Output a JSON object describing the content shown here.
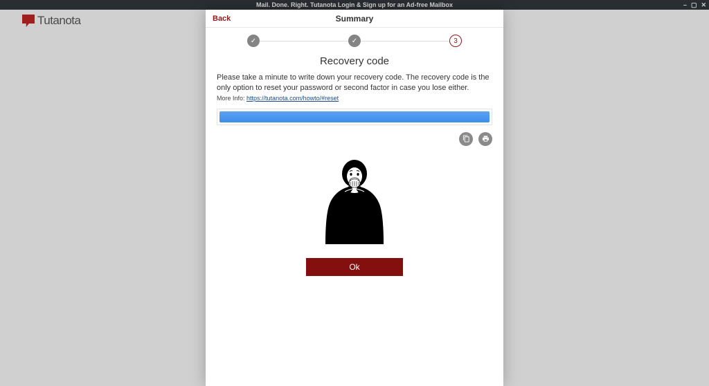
{
  "window": {
    "title": "Mail. Done. Right. Tutanota Login & Sign up for an Ad-free Mailbox"
  },
  "brand": {
    "name": "Tutanota"
  },
  "modal": {
    "back_label": "Back",
    "header_title": "Summary",
    "stepper": {
      "step1": "✓",
      "step2": "✓",
      "step3": "3"
    },
    "section_title": "Recovery code",
    "description": "Please take a minute to write down your recovery code. The recovery code is the only option to reset your password or second factor in case you lose either.",
    "more_info_label": "More Info:",
    "more_info_link_text": "https://tutanota.com/howto/#reset",
    "ok_label": "Ok"
  }
}
